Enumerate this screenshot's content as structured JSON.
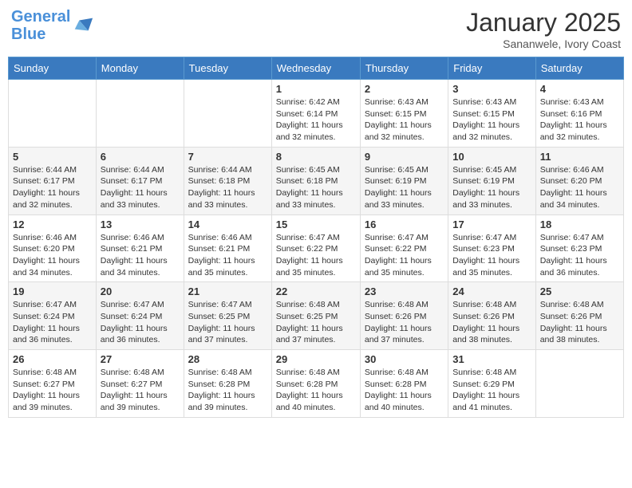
{
  "logo": {
    "line1": "General",
    "line2": "Blue"
  },
  "title": "January 2025",
  "location": "Sananwele, Ivory Coast",
  "days_of_week": [
    "Sunday",
    "Monday",
    "Tuesday",
    "Wednesday",
    "Thursday",
    "Friday",
    "Saturday"
  ],
  "weeks": [
    [
      {
        "day": "",
        "info": ""
      },
      {
        "day": "",
        "info": ""
      },
      {
        "day": "",
        "info": ""
      },
      {
        "day": "1",
        "info": "Sunrise: 6:42 AM\nSunset: 6:14 PM\nDaylight: 11 hours and 32 minutes."
      },
      {
        "day": "2",
        "info": "Sunrise: 6:43 AM\nSunset: 6:15 PM\nDaylight: 11 hours and 32 minutes."
      },
      {
        "day": "3",
        "info": "Sunrise: 6:43 AM\nSunset: 6:15 PM\nDaylight: 11 hours and 32 minutes."
      },
      {
        "day": "4",
        "info": "Sunrise: 6:43 AM\nSunset: 6:16 PM\nDaylight: 11 hours and 32 minutes."
      }
    ],
    [
      {
        "day": "5",
        "info": "Sunrise: 6:44 AM\nSunset: 6:17 PM\nDaylight: 11 hours and 32 minutes."
      },
      {
        "day": "6",
        "info": "Sunrise: 6:44 AM\nSunset: 6:17 PM\nDaylight: 11 hours and 33 minutes."
      },
      {
        "day": "7",
        "info": "Sunrise: 6:44 AM\nSunset: 6:18 PM\nDaylight: 11 hours and 33 minutes."
      },
      {
        "day": "8",
        "info": "Sunrise: 6:45 AM\nSunset: 6:18 PM\nDaylight: 11 hours and 33 minutes."
      },
      {
        "day": "9",
        "info": "Sunrise: 6:45 AM\nSunset: 6:19 PM\nDaylight: 11 hours and 33 minutes."
      },
      {
        "day": "10",
        "info": "Sunrise: 6:45 AM\nSunset: 6:19 PM\nDaylight: 11 hours and 33 minutes."
      },
      {
        "day": "11",
        "info": "Sunrise: 6:46 AM\nSunset: 6:20 PM\nDaylight: 11 hours and 34 minutes."
      }
    ],
    [
      {
        "day": "12",
        "info": "Sunrise: 6:46 AM\nSunset: 6:20 PM\nDaylight: 11 hours and 34 minutes."
      },
      {
        "day": "13",
        "info": "Sunrise: 6:46 AM\nSunset: 6:21 PM\nDaylight: 11 hours and 34 minutes."
      },
      {
        "day": "14",
        "info": "Sunrise: 6:46 AM\nSunset: 6:21 PM\nDaylight: 11 hours and 35 minutes."
      },
      {
        "day": "15",
        "info": "Sunrise: 6:47 AM\nSunset: 6:22 PM\nDaylight: 11 hours and 35 minutes."
      },
      {
        "day": "16",
        "info": "Sunrise: 6:47 AM\nSunset: 6:22 PM\nDaylight: 11 hours and 35 minutes."
      },
      {
        "day": "17",
        "info": "Sunrise: 6:47 AM\nSunset: 6:23 PM\nDaylight: 11 hours and 35 minutes."
      },
      {
        "day": "18",
        "info": "Sunrise: 6:47 AM\nSunset: 6:23 PM\nDaylight: 11 hours and 36 minutes."
      }
    ],
    [
      {
        "day": "19",
        "info": "Sunrise: 6:47 AM\nSunset: 6:24 PM\nDaylight: 11 hours and 36 minutes."
      },
      {
        "day": "20",
        "info": "Sunrise: 6:47 AM\nSunset: 6:24 PM\nDaylight: 11 hours and 36 minutes."
      },
      {
        "day": "21",
        "info": "Sunrise: 6:47 AM\nSunset: 6:25 PM\nDaylight: 11 hours and 37 minutes."
      },
      {
        "day": "22",
        "info": "Sunrise: 6:48 AM\nSunset: 6:25 PM\nDaylight: 11 hours and 37 minutes."
      },
      {
        "day": "23",
        "info": "Sunrise: 6:48 AM\nSunset: 6:26 PM\nDaylight: 11 hours and 37 minutes."
      },
      {
        "day": "24",
        "info": "Sunrise: 6:48 AM\nSunset: 6:26 PM\nDaylight: 11 hours and 38 minutes."
      },
      {
        "day": "25",
        "info": "Sunrise: 6:48 AM\nSunset: 6:26 PM\nDaylight: 11 hours and 38 minutes."
      }
    ],
    [
      {
        "day": "26",
        "info": "Sunrise: 6:48 AM\nSunset: 6:27 PM\nDaylight: 11 hours and 39 minutes."
      },
      {
        "day": "27",
        "info": "Sunrise: 6:48 AM\nSunset: 6:27 PM\nDaylight: 11 hours and 39 minutes."
      },
      {
        "day": "28",
        "info": "Sunrise: 6:48 AM\nSunset: 6:28 PM\nDaylight: 11 hours and 39 minutes."
      },
      {
        "day": "29",
        "info": "Sunrise: 6:48 AM\nSunset: 6:28 PM\nDaylight: 11 hours and 40 minutes."
      },
      {
        "day": "30",
        "info": "Sunrise: 6:48 AM\nSunset: 6:28 PM\nDaylight: 11 hours and 40 minutes."
      },
      {
        "day": "31",
        "info": "Sunrise: 6:48 AM\nSunset: 6:29 PM\nDaylight: 11 hours and 41 minutes."
      },
      {
        "day": "",
        "info": ""
      }
    ]
  ]
}
